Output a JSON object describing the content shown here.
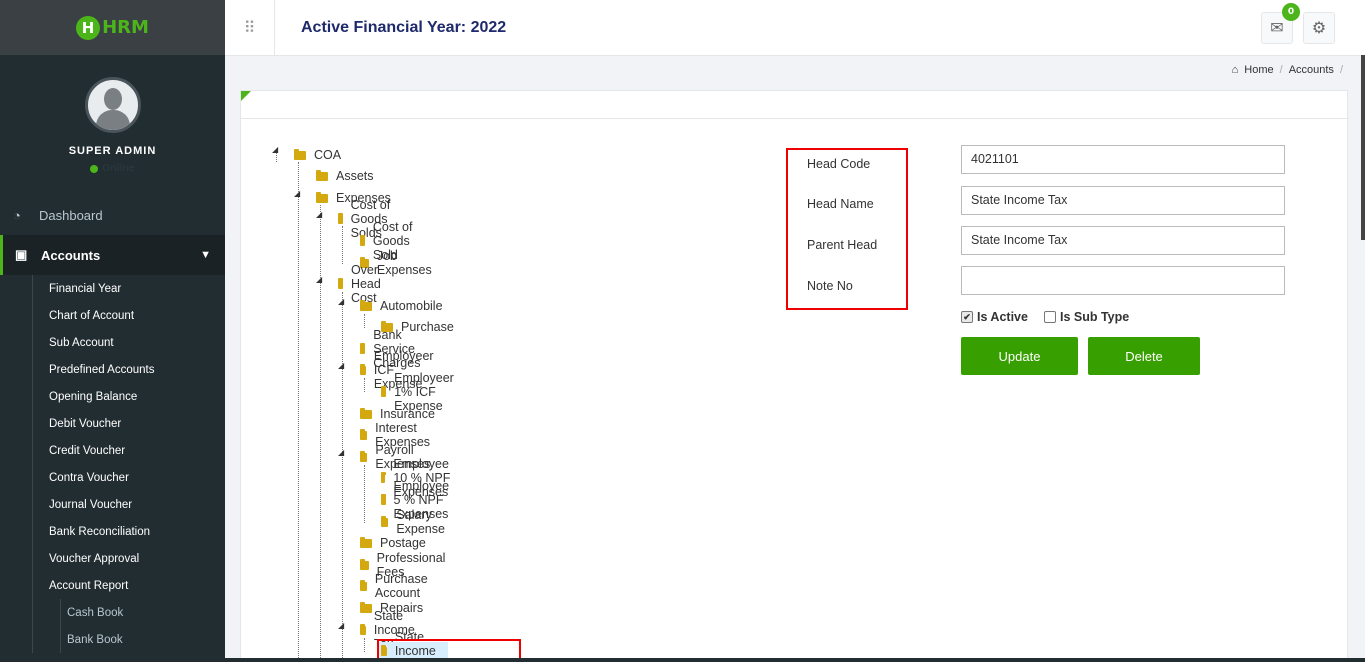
{
  "app": {
    "logo_text": "HRM",
    "logo_letter": "H"
  },
  "header": {
    "title": "Active Financial Year: 2022",
    "mail_badge": "0"
  },
  "profile": {
    "name": "SUPER ADMIN",
    "status": "Online"
  },
  "sidebar": {
    "dashboard": "Dashboard",
    "accounts": "Accounts",
    "items": [
      {
        "label": "Financial Year"
      },
      {
        "label": "Chart of Account"
      },
      {
        "label": "Sub Account"
      },
      {
        "label": "Predefined Accounts"
      },
      {
        "label": "Opening Balance"
      },
      {
        "label": "Debit Voucher"
      },
      {
        "label": "Credit Voucher"
      },
      {
        "label": "Contra Voucher"
      },
      {
        "label": "Journal Voucher"
      },
      {
        "label": "Bank Reconciliation"
      },
      {
        "label": "Voucher Approval"
      },
      {
        "label": "Account Report"
      }
    ],
    "report_items": [
      {
        "label": "Cash Book"
      },
      {
        "label": "Bank Book"
      }
    ]
  },
  "breadcrumb": {
    "home": "Home",
    "current": "Accounts"
  },
  "tree": [
    {
      "label": "COA"
    },
    {
      "label": "Assets"
    },
    {
      "label": "Expenses"
    },
    {
      "label": "Cost of Goods Solds"
    },
    {
      "label": "Cost of Goods Sold"
    },
    {
      "label": "Job Expenses"
    },
    {
      "label": "Over Head Cost"
    },
    {
      "label": "Automobile"
    },
    {
      "label": "Purchase"
    },
    {
      "label": "Bank Service Charges"
    },
    {
      "label": "Employeer ICF Expense"
    },
    {
      "label": "Employeer 1% ICF Expense"
    },
    {
      "label": "Insurance"
    },
    {
      "label": "Interest Expenses"
    },
    {
      "label": "Payroll Expenses"
    },
    {
      "label": "Employee 10 % NPF Expenses"
    },
    {
      "label": "Employee 5 % NPF Expenses"
    },
    {
      "label": "Salary Expense"
    },
    {
      "label": "Postage"
    },
    {
      "label": "Professional Fees"
    },
    {
      "label": "Purchase Account"
    },
    {
      "label": "Repairs"
    },
    {
      "label": "State Income Tax"
    },
    {
      "label": "State Income Tax"
    }
  ],
  "form": {
    "head_code_label": "Head Code",
    "head_name_label": "Head Name",
    "parent_head_label": "Parent Head",
    "note_no_label": "Note No",
    "head_code": "4021101",
    "head_name": "State Income Tax",
    "parent_head": "State Income Tax",
    "note_no": "",
    "is_active_label": "Is Active",
    "is_sub_type_label": "Is Sub Type",
    "is_active": true,
    "is_sub_type": false,
    "update_label": "Update",
    "delete_label": "Delete"
  },
  "colors": {
    "accent": "#37a000",
    "sidebar": "#222d32",
    "title": "#1e2a6b",
    "highlight": "#e00000"
  }
}
